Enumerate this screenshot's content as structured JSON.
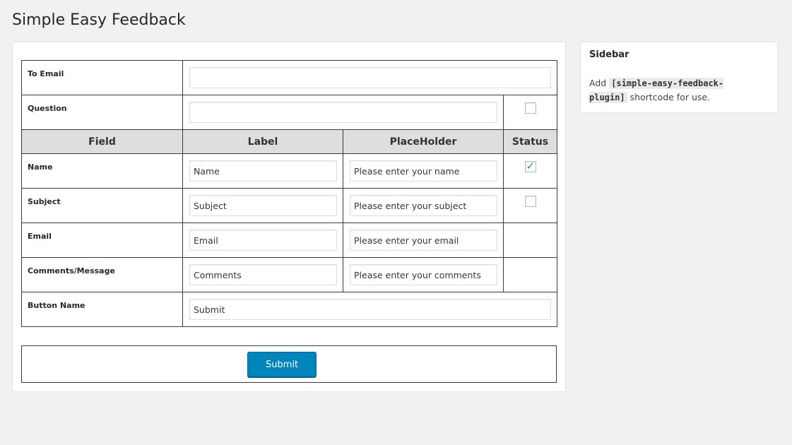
{
  "page": {
    "title": "Simple Easy Feedback"
  },
  "form": {
    "to_email": {
      "label": "To Email",
      "value": ""
    },
    "question": {
      "label": "Question",
      "value": "",
      "status_checked": false
    },
    "headers": {
      "field": "Field",
      "label": "Label",
      "placeholder": "PlaceHolder",
      "status": "Status"
    },
    "fields": [
      {
        "field": "Name",
        "label": "Name",
        "placeholder": "Please enter your name",
        "status": "checked"
      },
      {
        "field": "Subject",
        "label": "Subject",
        "placeholder": "Please enter your subject",
        "status": "unchecked"
      },
      {
        "field": "Email",
        "label": "Email",
        "placeholder": "Please enter your email",
        "status": "none"
      },
      {
        "field": "Comments/Message",
        "label": "Comments",
        "placeholder": "Please enter your comments",
        "status": "none"
      }
    ],
    "button_name": {
      "label": "Button Name",
      "value": "Submit"
    },
    "submit_label": "Submit"
  },
  "sidebar": {
    "title": "Sidebar",
    "text_prefix": "Add",
    "shortcode": "[simple-easy-feedback-plugin]",
    "text_suffix": "shortcode for use."
  },
  "colors": {
    "accent": "#0085ba",
    "header_bg": "#dedede",
    "background": "#f1f1f1",
    "check": "#1e8cbe"
  }
}
